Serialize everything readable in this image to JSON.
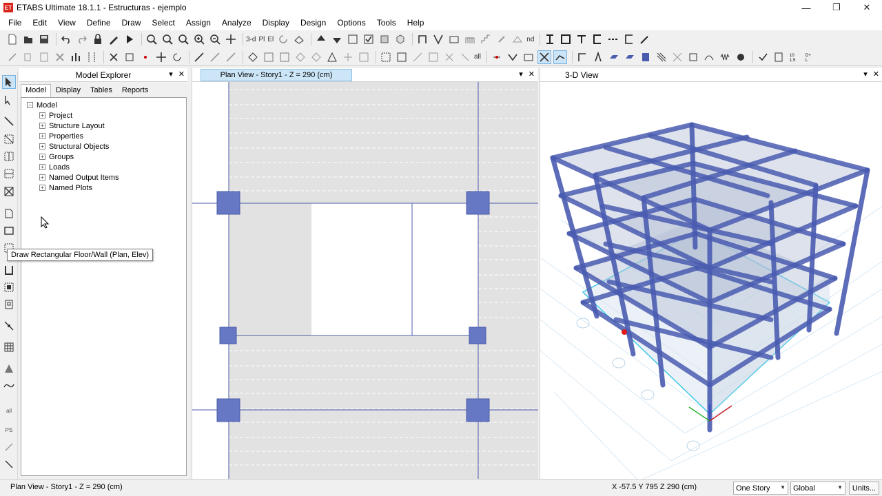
{
  "window": {
    "title": "ETABS Ultimate 18.1.1 - Estructuras - ejemplo",
    "app_icon_text": "ET"
  },
  "menu": [
    "File",
    "Edit",
    "View",
    "Define",
    "Draw",
    "Select",
    "Assign",
    "Analyze",
    "Display",
    "Design",
    "Options",
    "Tools",
    "Help"
  ],
  "toolbar": {
    "view_3d_label": "3-d",
    "plan_label": "Pl",
    "elev_label": "El",
    "nd_label": "nd",
    "all_label": "all",
    "ps_label": "PS"
  },
  "model_explorer": {
    "title": "Model Explorer",
    "tabs": [
      "Model",
      "Display",
      "Tables",
      "Reports"
    ],
    "tree_root": "Model",
    "tree_items": [
      "Project",
      "Structure Layout",
      "Properties",
      "Structural Objects",
      "Groups",
      "Loads",
      "Named Output Items",
      "Named Plots"
    ]
  },
  "tooltip": "Draw Rectangular Floor/Wall (Plan, Elev)",
  "plan_view": {
    "title": "Plan View - Story1 - Z = 290 (cm)"
  },
  "view_3d": {
    "title": "3-D View"
  },
  "status": {
    "left_text": "Plan View - Story1 - Z = 290 (cm)",
    "coords": "X -57.5  Y 795  Z 290 (cm)",
    "story_option": "One Story",
    "coord_system": "Global",
    "units_button": "Units..."
  },
  "colors": {
    "frame_blue": "#4a5cb0",
    "selection_cyan": "#3cc8e8",
    "accent": "#0078d7"
  }
}
